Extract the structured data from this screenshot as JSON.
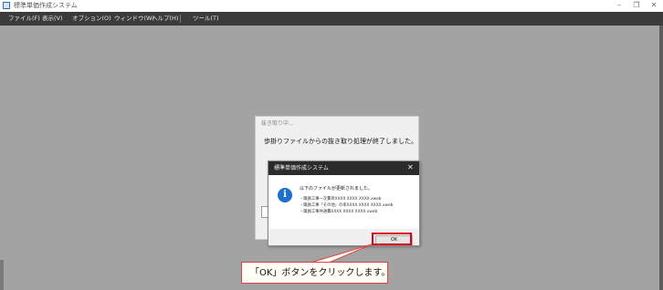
{
  "window": {
    "title": "標準単価作成システム",
    "controls": {
      "minimize": "–",
      "restore": "❐",
      "close": "✕"
    }
  },
  "menu": {
    "items": [
      "ファイル(F)",
      "表示(V)",
      "オプション(O)",
      "ウィンドウ(W)",
      "ヘルプ(H)",
      "ツール(T)"
    ]
  },
  "progress_dialog": {
    "title": "抜き取り中...",
    "message": "歩掛りファイルからの抜き取り処理が終了しました。"
  },
  "message_box": {
    "title": "標準単価作成システム",
    "close": "✕",
    "icon": "info-icon",
    "icon_glyph": "i",
    "main_text": "以下のファイルが更新されました。",
    "files": [
      "・職員工事一次費目XXXX XXXX XXXX.xweb",
      "・職員工事「その他」の率XXXX XXXX XXXX.xweb",
      "・職員工事共通費XXXX XXXX XXXX.xweb"
    ],
    "ok_label": "OK"
  },
  "callout": {
    "text": "「OK」ボタンをクリックします。",
    "border_color": "#d94545",
    "highlight_color": "#d9001b"
  }
}
